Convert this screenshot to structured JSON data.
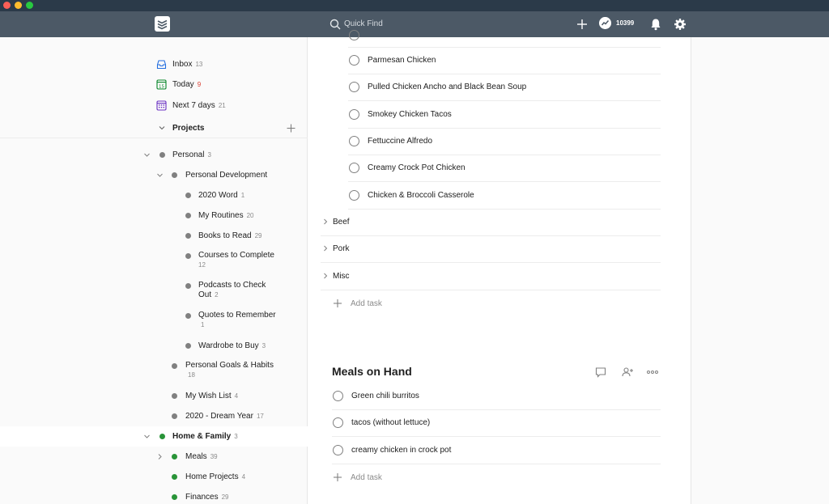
{
  "colors": {
    "topbar": "#4c5966",
    "titlebar": "#2b3a49",
    "accent_green": "#299438",
    "today_red": "#db4035",
    "gray_dot": "#808080"
  },
  "topbar": {
    "search_placeholder": "Quick Find",
    "karma_count": "10399",
    "icons": [
      "todoist-logo-icon",
      "search-icon",
      "add-icon",
      "karma-icon",
      "bell-icon",
      "gear-icon"
    ]
  },
  "sidebar": {
    "nav": [
      {
        "label": "Inbox",
        "count": "13",
        "icon": "inbox-icon"
      },
      {
        "label": "Today",
        "count": "9",
        "icon": "today-calendar-icon"
      },
      {
        "label": "Next 7 days",
        "count": "21",
        "icon": "upcoming-calendar-icon"
      }
    ],
    "projects_label": "Projects",
    "projects": [
      {
        "label": "Personal",
        "count": "3"
      },
      {
        "label": "Personal Development",
        "count": ""
      },
      {
        "label": "2020 Word",
        "count": "1"
      },
      {
        "label": "My Routines",
        "count": "20"
      },
      {
        "label": "Books to Read",
        "count": "29"
      },
      {
        "label": "Courses to Complete",
        "count": "12"
      },
      {
        "label": "Podcasts to Check Out",
        "count": "2"
      },
      {
        "label": "Quotes to Remember",
        "count": "1"
      },
      {
        "label": "Wardrobe to Buy",
        "count": "3"
      },
      {
        "label": "Personal Goals & Habits",
        "count": "18"
      },
      {
        "label": "My Wish List",
        "count": "4"
      },
      {
        "label": "2020 - Dream Year",
        "count": "17"
      },
      {
        "label": "Home & Family",
        "count": "3"
      },
      {
        "label": "Meals",
        "count": "39"
      },
      {
        "label": "Home Projects",
        "count": "4"
      },
      {
        "label": "Finances",
        "count": "29"
      }
    ]
  },
  "main": {
    "chicken_tasks": [
      "Parmesan Chicken",
      "Pulled Chicken Ancho and Black Bean Soup",
      "Smokey Chicken Tacos",
      "Fettuccine Alfredo",
      "Creamy Crock Pot Chicken",
      "Chicken & Broccoli Casserole"
    ],
    "subsections": [
      "Beef",
      "Pork",
      "Misc"
    ],
    "add_task_label": "Add task",
    "meals_on_hand": {
      "title": "Meals on Hand",
      "tasks": [
        "Green chili burritos",
        "tacos (without lettuce)",
        "creamy chicken in crock pot"
      ],
      "add_task_label": "Add task"
    }
  }
}
